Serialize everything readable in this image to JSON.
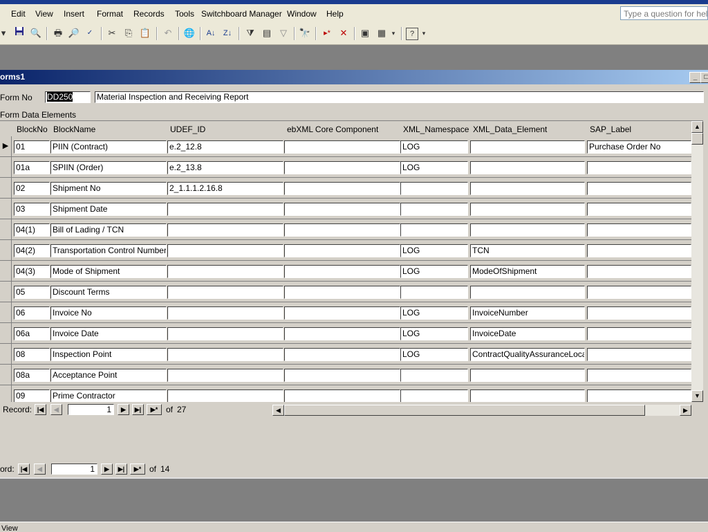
{
  "menubar": {
    "items": [
      "Edit",
      "View",
      "Insert",
      "Format",
      "Records",
      "Tools",
      "Switchboard Manager",
      "Window",
      "Help"
    ],
    "ask_placeholder": "Type a question for help"
  },
  "toolbar": {
    "icons": [
      "save-icon",
      "search-file-icon",
      "print-icon",
      "print-preview-icon",
      "spelling-icon",
      "cut-icon",
      "copy-icon",
      "paste-icon",
      "undo-icon",
      "hyperlink-icon",
      "sort-ascending-icon",
      "sort-descending-icon",
      "filter-by-selection-icon",
      "filter-by-form-icon",
      "apply-filter-icon",
      "find-icon",
      "new-record-icon",
      "delete-record-icon",
      "database-window-icon",
      "new-object-icon",
      "help-icon"
    ]
  },
  "child_window": {
    "title": "orms1"
  },
  "form": {
    "form_no_label": "Form No",
    "form_no_value": "DD250",
    "form_title_value": "Material Inspection and Receiving Report",
    "subform_label": "Form Data Elements"
  },
  "subform": {
    "columns": [
      "BlockNo",
      "BlockName",
      "UDEF_ID",
      "ebXML Core Component",
      "XML_Namespace",
      "XML_Data_Element",
      "SAP_Label"
    ],
    "rows": [
      [
        "01",
        "PIIN (Contract)",
        "e.2_12.8",
        "",
        "LOG",
        "",
        "Purchase Order No"
      ],
      [
        "01a",
        "SPIIN (Order)",
        "e.2_13.8",
        "",
        "LOG",
        "",
        ""
      ],
      [
        "02",
        "Shipment No",
        "2_1.1.1.2.16.8",
        "",
        "",
        "",
        ""
      ],
      [
        "03",
        "Shipment Date",
        "",
        "",
        "",
        "",
        ""
      ],
      [
        "04(1)",
        "Bill of Lading / TCN",
        "",
        "",
        "",
        "",
        ""
      ],
      [
        "04(2)",
        "Transportation Control Number (",
        "",
        "",
        "LOG",
        "TCN",
        ""
      ],
      [
        "04(3)",
        "Mode of Shipment",
        "",
        "",
        "LOG",
        "ModeOfShipment",
        ""
      ],
      [
        "05",
        "Discount Terms",
        "",
        "",
        "",
        "",
        ""
      ],
      [
        "06",
        "Invoice No",
        "",
        "",
        "LOG",
        "InvoiceNumber",
        ""
      ],
      [
        "06a",
        "Invoice Date",
        "",
        "",
        "LOG",
        "InvoiceDate",
        ""
      ],
      [
        "08",
        "Inspection Point",
        "",
        "",
        "LOG",
        "ContractQualityAssuranceLocat",
        ""
      ],
      [
        "08a",
        "Acceptance Point",
        "",
        "",
        "",
        "",
        ""
      ],
      [
        "09",
        "Prime Contractor",
        "",
        "",
        "",
        "",
        ""
      ]
    ],
    "nav": {
      "label": "Record:",
      "current": "1",
      "of_label": "of",
      "total": "27"
    }
  },
  "main_nav": {
    "label": "ord:",
    "current": "1",
    "of_label": "of",
    "total": "14"
  },
  "statusbar": {
    "text": "View"
  }
}
